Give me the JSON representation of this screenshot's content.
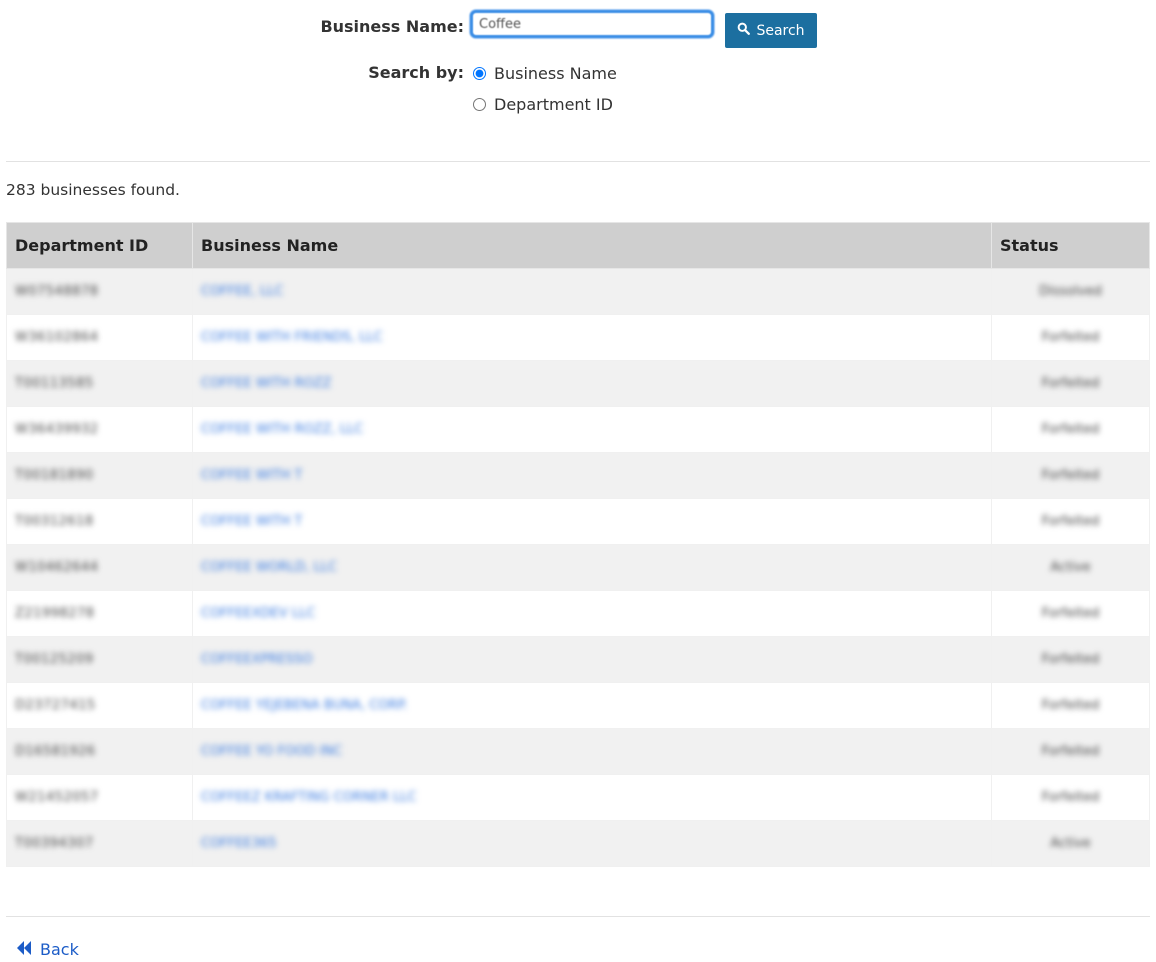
{
  "search": {
    "business_name_label": "Business Name:",
    "business_name_value": "Coffee",
    "button_label": "Search",
    "search_by_label": "Search by:",
    "options": [
      {
        "label": "Business Name",
        "checked": true
      },
      {
        "label": "Department ID",
        "checked": false
      }
    ]
  },
  "results": {
    "count_text": "283 businesses found.",
    "headers": {
      "department_id": "Department ID",
      "business_name": "Business Name",
      "status": "Status"
    },
    "rows": [
      {
        "id": "W07548878",
        "name": "COFFEE, LLC",
        "status": "Dissolved"
      },
      {
        "id": "W36102864",
        "name": "COFFEE WITH FRIENDS, LLC",
        "status": "Forfeited"
      },
      {
        "id": "T00113585",
        "name": "COFFEE WITH ROZZ",
        "status": "Forfeited"
      },
      {
        "id": "W36439932",
        "name": "COFFEE WITH ROZZ, LLC",
        "status": "Forfeited"
      },
      {
        "id": "T00181890",
        "name": "COFFEE WITH T",
        "status": "Forfeited"
      },
      {
        "id": "T00312618",
        "name": "COFFEE WITH T",
        "status": "Forfeited"
      },
      {
        "id": "W10462644",
        "name": "COFFEE WORLD, LLC",
        "status": "Active"
      },
      {
        "id": "Z21998278",
        "name": "COFFEEXDEV LLC",
        "status": "Forfeited"
      },
      {
        "id": "T00125209",
        "name": "COFFEEXPRESSO",
        "status": "Forfeited"
      },
      {
        "id": "D23727415",
        "name": "COFFEE YEJEBENA BUNA, CORP.",
        "status": "Forfeited"
      },
      {
        "id": "D16581926",
        "name": "COFFEE YO FOOD INC",
        "status": "Forfeited"
      },
      {
        "id": "W21452057",
        "name": "COFFEEZ KRAFTING CORNER LLC",
        "status": "Forfeited"
      },
      {
        "id": "T00394307",
        "name": "COFFEE365",
        "status": "Active"
      }
    ]
  },
  "nav": {
    "back_label": "Back"
  },
  "colors": {
    "button_bg": "#1c6fa0",
    "link": "#1c5cc7",
    "header_bg": "#cfcfcf",
    "input_focus": "#3d8fe6"
  }
}
